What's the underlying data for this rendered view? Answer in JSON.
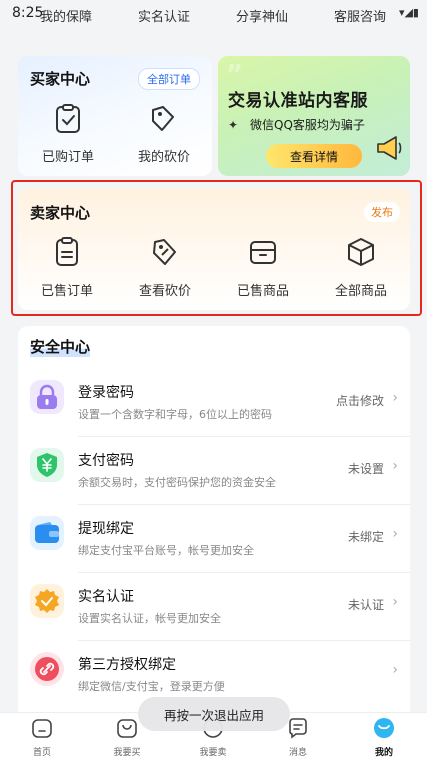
{
  "status_bar": {
    "time": "8:25"
  },
  "top_links": [
    "我的保障",
    "实名认证",
    "分享神仙",
    "客服咨询"
  ],
  "buyer_center": {
    "title": "买家中心",
    "all_orders": "全部订单",
    "items": [
      {
        "label": "已购订单",
        "icon": "clipboard-check-icon"
      },
      {
        "label": "我的砍价",
        "icon": "price-tag-icon"
      }
    ]
  },
  "banner": {
    "line1": "交易认准站内客服",
    "line2": "微信QQ客服均为骗子",
    "button": "查看详情",
    "colors": {
      "bg_start": "#d9f6a8",
      "bg_end": "#c3edd8",
      "btn": "#ffc94d"
    }
  },
  "seller_center": {
    "title": "卖家中心",
    "publish": "发布",
    "items": [
      {
        "label": "已售订单",
        "icon": "clipboard-icon"
      },
      {
        "label": "查看砍价",
        "icon": "price-tag-icon"
      },
      {
        "label": "已售商品",
        "icon": "box-icon"
      },
      {
        "label": "全部商品",
        "icon": "cube-icon"
      }
    ]
  },
  "security_center": {
    "title": "安全中心",
    "rows": [
      {
        "title": "登录密码",
        "subtitle": "设置一个含数字和字母，6位以上的密码",
        "status": "点击修改",
        "icon": "lock-icon",
        "color": "#9b7cf0"
      },
      {
        "title": "支付密码",
        "subtitle": "余额交易时，支付密码保护您的资金安全",
        "status": "未设置",
        "icon": "yuan-shield-icon",
        "color": "#2ec46a"
      },
      {
        "title": "提现绑定",
        "subtitle": "绑定支付宝平台账号，帐号更加安全",
        "status": "未绑定",
        "icon": "wallet-icon",
        "color": "#2a8ef0"
      },
      {
        "title": "实名认证",
        "subtitle": "设置实名认证，帐号更加安全",
        "status": "未认证",
        "icon": "verified-badge-icon",
        "color": "#f5a623"
      },
      {
        "title": "第三方授权绑定",
        "subtitle": "绑定微信/支付宝，登录更方便",
        "status": "",
        "icon": "link-icon",
        "color": "#f04e5e"
      }
    ]
  },
  "tab_bar": [
    {
      "label": "首页",
      "icon": "home-icon"
    },
    {
      "label": "我要买",
      "icon": "shopping-bag-icon"
    },
    {
      "label": "我要卖",
      "icon": "sell-icon"
    },
    {
      "label": "消息",
      "icon": "message-icon"
    },
    {
      "label": "我的",
      "icon": "profile-icon",
      "active": true
    }
  ],
  "toast": "再按一次退出应用"
}
